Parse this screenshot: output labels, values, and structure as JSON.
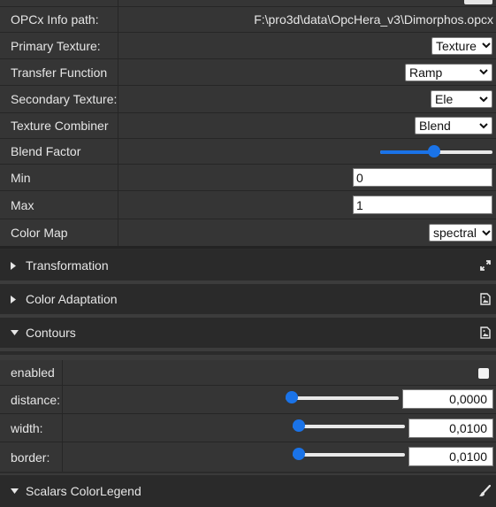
{
  "rows": {
    "opcx_info_path": {
      "label": "OPCx Info path:",
      "value": "F:\\pro3d\\data\\OpcHera_v3\\Dimorphos.opcx"
    },
    "primary_texture": {
      "label": "Primary Texture:",
      "selected": "Texture"
    },
    "transfer_function": {
      "label": "Transfer Function",
      "selected": "Ramp"
    },
    "secondary_texture": {
      "label": "Secondary Texture:",
      "selected": "Ele"
    },
    "texture_combiner": {
      "label": "Texture Combiner",
      "selected": "Blend"
    },
    "blend_factor": {
      "label": "Blend Factor",
      "level_fraction": 0.48
    },
    "min": {
      "label": "Min",
      "value": "0"
    },
    "max": {
      "label": "Max",
      "value": "1"
    },
    "color_map": {
      "label": "Color Map",
      "selected": "spectral"
    }
  },
  "sections": {
    "transformation": {
      "title": "Transformation",
      "expanded": false,
      "icon": "expand-arrows-icon"
    },
    "color_adaptation": {
      "title": "Color Adaptation",
      "expanded": false,
      "icon": "image-file-icon"
    },
    "contours": {
      "title": "Contours",
      "expanded": true,
      "icon": "image-file-icon"
    },
    "scalars_color_legend": {
      "title": "Scalars ColorLegend",
      "expanded": true,
      "icon": "paintbrush-icon"
    }
  },
  "contours": {
    "enabled": {
      "label": "enabled",
      "checked": false
    },
    "distance": {
      "label": "distance:",
      "value": "0,0000",
      "slider_fraction": 0.0
    },
    "width": {
      "label": "width:",
      "value": "0,0100",
      "slider_fraction": 0.0
    },
    "border": {
      "label": "border:",
      "value": "0,0100",
      "slider_fraction": 0.0
    }
  },
  "colors": {
    "accent": "#1a73e8",
    "panel": "#353535",
    "header": "#2a2a2a"
  }
}
